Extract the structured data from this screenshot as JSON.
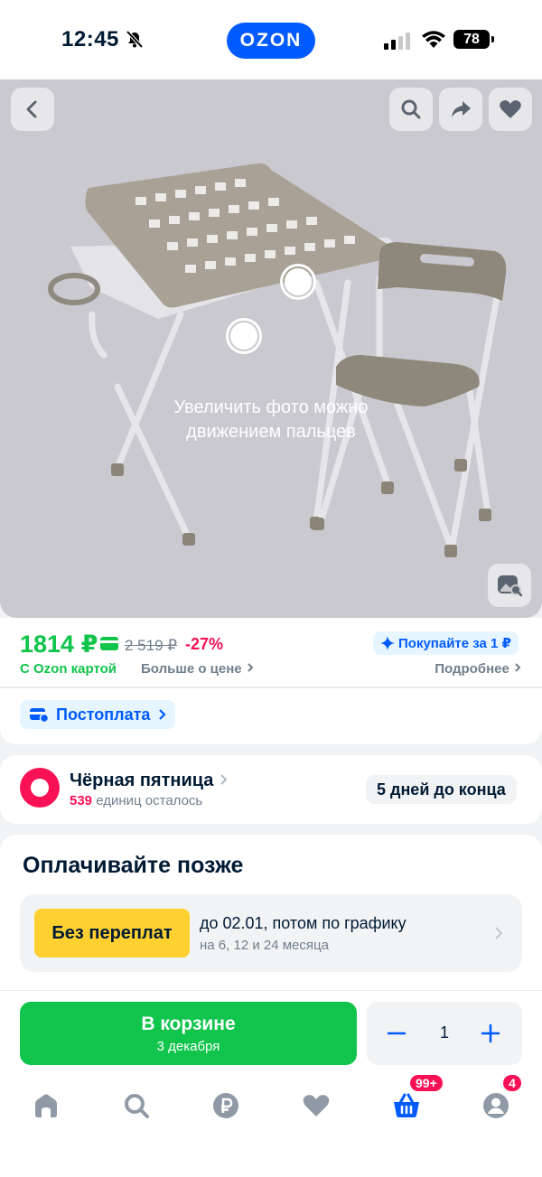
{
  "status_bar": {
    "time": "12:45",
    "battery": "78"
  },
  "brand": {
    "logo_text": "OZON"
  },
  "gallery": {
    "zoom_hint_line1": "Увеличить фото можно",
    "zoom_hint_line2": "движением пальцев"
  },
  "price": {
    "card_price": "1814 ₽",
    "old_price": "2 519 ₽",
    "discount": "-27%",
    "buy_for_1": "Покупайте за 1 ₽",
    "ozon_card_label": "С Ozon картой",
    "more_about_price": "Больше о цене",
    "details": "Подробнее"
  },
  "postpay": {
    "label": "Постоплата"
  },
  "promo": {
    "title": "Чёрная пятница",
    "remaining_count": "539",
    "remaining_text": "единиц осталось",
    "timer": "5 дней до конца"
  },
  "pay_later": {
    "title": "Оплачивайте позже",
    "badge": "Без переплат",
    "line1": "до 02.01, потом по графику",
    "line2": "на 6, 12 и 24 месяца"
  },
  "cart": {
    "button_label": "В корзине",
    "delivery_date": "3 декабря",
    "quantity": "1"
  },
  "nav": {
    "cart_badge": "99+",
    "profile_badge": "4"
  },
  "colors": {
    "ozon_blue": "#005bff",
    "green": "#10c44c",
    "pink": "#f91155",
    "yellow": "#ffd030"
  }
}
